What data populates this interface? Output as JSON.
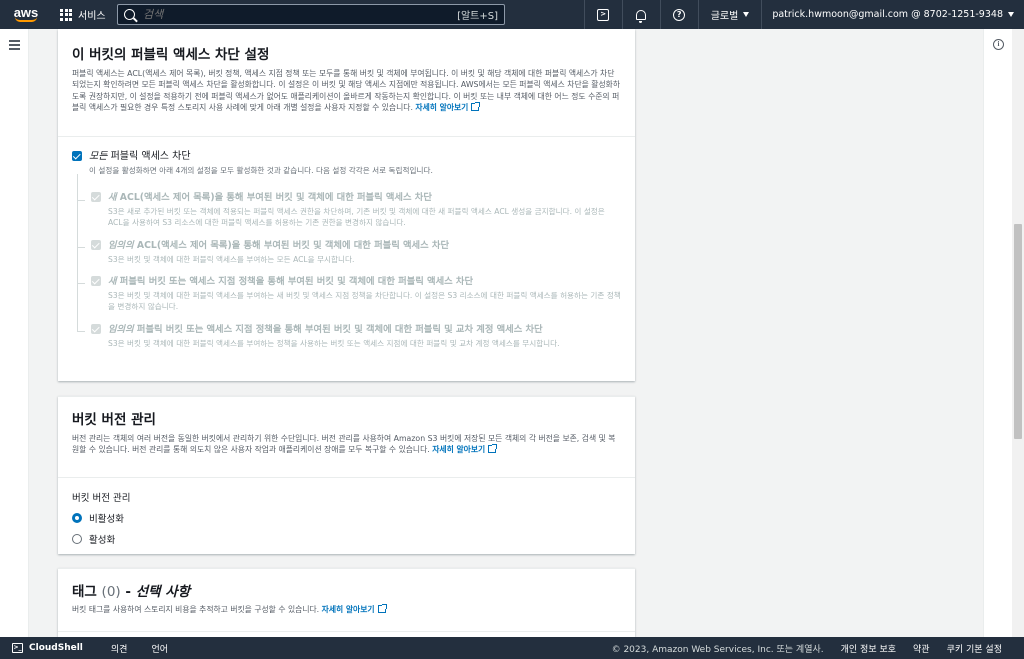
{
  "topnav": {
    "logo": "aws",
    "services_label": "서비스",
    "search_placeholder": "검색",
    "search_shortcut": "[알트+S]",
    "region_label": "글로벌",
    "account_label": "patrick.hwmoon@gmail.com @ 8702-1251-9348"
  },
  "block_public_access": {
    "title": "이 버킷의 퍼블릭 액세스 차단 설정",
    "description": "퍼블릭 액세스는 ACL(액세스 제어 목록), 버킷 정책, 액세스 지점 정책 또는 모두를 통해 버킷 및 객체에 부여됩니다. 이 버킷 및 해당 객체에 대한 퍼블릭 액세스가 차단되었는지 확인하려면 모든 퍼블릭 액세스 차단을 활성화합니다. 이 설정은 이 버킷 및 해당 액세스 지점에만 적용됩니다. AWS에서는 모든 퍼블릭 액세스 차단을 활성화하도록 권장하지만, 이 설정을 적용하기 전에 퍼블릭 액세스가 없어도 애플리케이션이 올바르게 작동하는지 확인합니다. 이 버킷 또는 내부 객체에 대한 어느 정도 수준의 퍼블릭 액세스가 필요한 경우 특정 스토리지 사용 사례에 맞게 아래 개별 설정을 사용자 지정할 수 있습니다.",
    "learn_more": "자세히 알아보기",
    "all": {
      "title_em": "모든",
      "title_rest": " 퍼블릭 액세스 차단",
      "desc": "이 설정을 활성화하면 아래 4개의 설정을 모두 활성화한 것과 같습니다. 다음 설정 각각은 서로 독립적입니다."
    },
    "options": [
      {
        "title_em": "새",
        "title_rest": " ACL(액세스 제어 목록)을 통해 부여된 버킷 및 객체에 대한 퍼블릭 액세스 차단",
        "desc": "S3은 새로 추가된 버킷 또는 객체에 적용되는 퍼블릭 액세스 권한을 차단하며, 기존 버킷 및 객체에 대한 새 퍼블릭 액세스 ACL 생성을 금지합니다. 이 설정은 ACL을 사용하여 S3 리소스에 대한 퍼블릭 액세스를 허용하는 기존 권한을 변경하지 않습니다."
      },
      {
        "title_em": "임의의",
        "title_rest": " ACL(액세스 제어 목록)을 통해 부여된 버킷 및 객체에 대한 퍼블릭 액세스 차단",
        "desc": "S3은 버킷 및 객체에 대한 퍼블릭 액세스를 부여하는 모든 ACL을 무시합니다."
      },
      {
        "title_em": "새",
        "title_rest": " 퍼블릭 버킷 또는 액세스 지점 정책을 통해 부여된 버킷 및 객체에 대한 퍼블릭 액세스 차단",
        "desc": "S3은 버킷 및 객체에 대한 퍼블릭 액세스를 부여하는 새 버킷 및 액세스 지점 정책을 차단합니다. 이 설정은 S3 리소스에 대한 퍼블릭 액세스를 허용하는 기존 정책을 변경하지 않습니다."
      },
      {
        "title_em": "임의의",
        "title_rest": " 퍼블릭 버킷 또는 액세스 지점 정책을 통해 부여된 버킷 및 객체에 대한 퍼블릭 및 교차 계정 액세스 차단",
        "desc": "S3은 버킷 및 객체에 대한 퍼블릭 액세스를 부여하는 정책을 사용하는 버킷 또는 액세스 지점에 대한 퍼블릭 및 교차 계정 액세스를 무시합니다."
      }
    ]
  },
  "versioning": {
    "title": "버킷 버전 관리",
    "description": "버전 관리는 객체의 여러 버전을 동일한 버킷에서 관리하기 위한 수단입니다. 버전 관리를 사용하여 Amazon S3 버킷에 저장된 모든 객체의 각 버전을 보존, 검색 및 복원할 수 있습니다. 버전 관리를 통해 의도치 않은 사용자 작업과 애플리케이션 장애를 모두 복구할 수 있습니다.",
    "learn_more": "자세히 알아보기",
    "field_label": "버킷 버전 관리",
    "option_disable": "비활성화",
    "option_enable": "활성화"
  },
  "tags": {
    "title": "태그",
    "count": "(0)",
    "optional": "선택 사항",
    "description": "버킷 태그를 사용하여 스토리지 비용을 추적하고 버킷을 구성할 수 있습니다.",
    "learn_more": "자세히 알아보기"
  },
  "footer": {
    "cloudshell": "CloudShell",
    "feedback": "의견",
    "language": "언어",
    "copyright": "© 2023, Amazon Web Services, Inc. 또는 계열사.",
    "privacy": "개인 정보 보호",
    "terms": "약관",
    "cookies": "쿠키 기본 설정"
  }
}
